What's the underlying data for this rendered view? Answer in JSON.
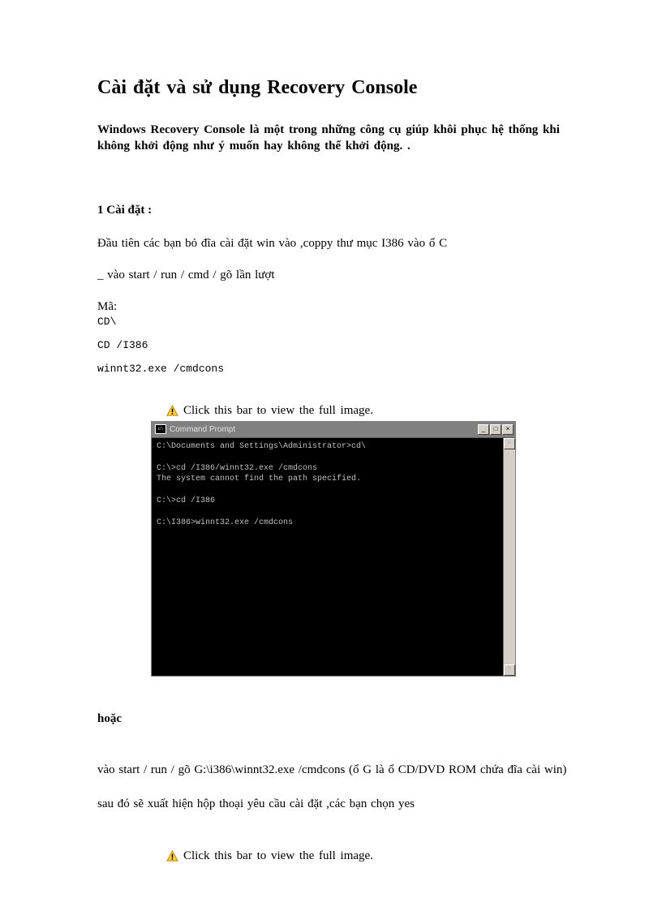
{
  "title": "Cài đặt và sử dụng Recovery Console",
  "intro": "Windows Recovery Console là một trong những công cụ giúp khôi phục hệ thống khi không khởi động như ý muốn hay không thể khởi động. .",
  "section1": "1 Cài đặt :",
  "p1": "Đầu tiên các bạn bỏ đĩa cài đặt win vào ,coppy thư mục I386 vào ổ C",
  "p2": "_ vào start / run / cmd / gõ lần lượt",
  "code_label": "Mã:",
  "code1": "CD\\",
  "code2": "CD /I386",
  "code3": "winnt32.exe /cmdcons",
  "click_bar": "Click this bar to view the full image.",
  "cmd": {
    "title": "Command Prompt",
    "lines": "C:\\Documents and Settings\\Administrator>cd\\\n\nC:\\>cd /I386/winnt32.exe /cmdcons\nThe system cannot find the path specified.\n\nC:\\>cd /I386\n\nC:\\I386>winnt32.exe /cmdcons"
  },
  "or": "hoặc",
  "p3": "vào start / run / gõ G:\\i386\\winnt32.exe   /cmdcons (ổ G là ổ CD/DVD ROM chứa đĩa cài win)",
  "p4": "sau đó sẽ xuất hiện hộp thoại yêu cầu cài đặt ,các bạn chọn yes",
  "click_bar2": "Click this bar to view the full image."
}
